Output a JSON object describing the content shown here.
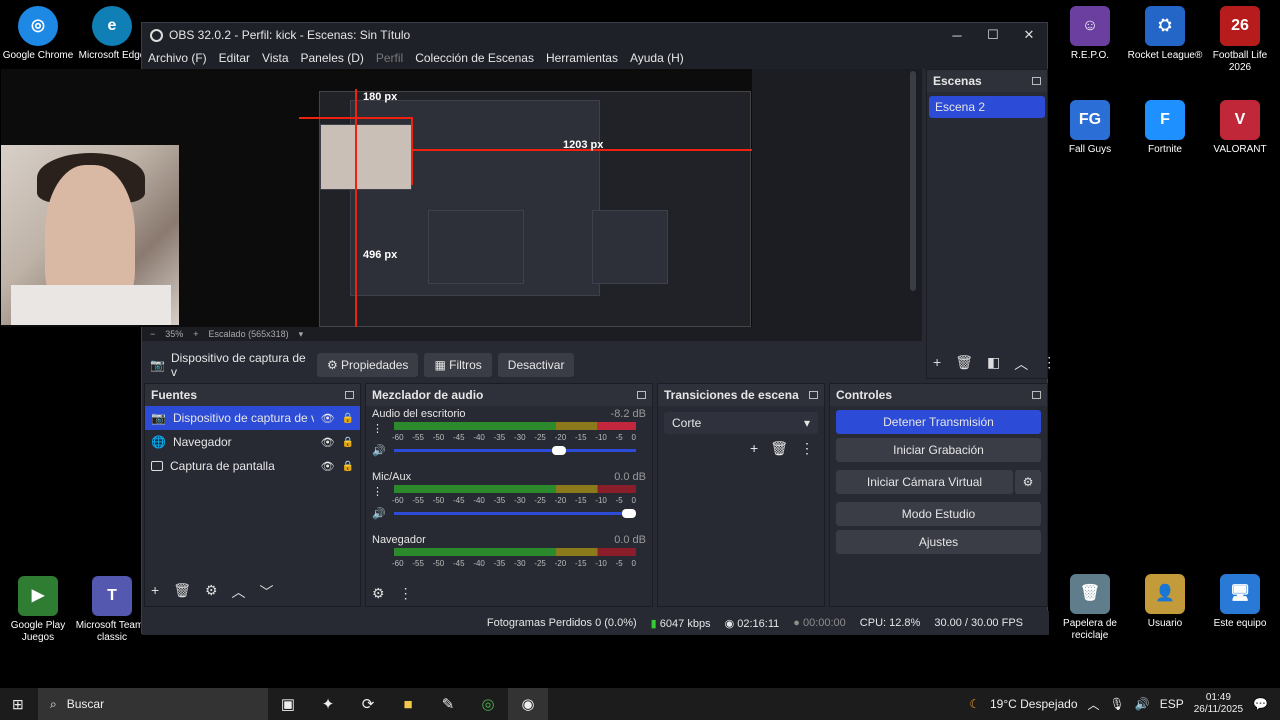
{
  "desktop": {
    "left_icons": [
      {
        "label": "Google Chrome",
        "color": "#1e88e5"
      },
      {
        "label": "Microsoft Edge",
        "color": "#0f7fb5"
      },
      {
        "label": "",
        "color": "#1b2838"
      },
      {
        "label": "",
        "color": "#222"
      },
      {
        "label": "Google Play Juegos",
        "color": "#2e7d32"
      },
      {
        "label": "Microsoft Teams classic",
        "color": "#5558af"
      }
    ],
    "right_icons": [
      {
        "label": "R.E.P.O.",
        "color": "#6a3fa0"
      },
      {
        "label": "Rocket League®",
        "color": "#2466c7"
      },
      {
        "label": "Football Life 2026",
        "color": "#b71c1c"
      },
      {
        "label": "Fall Guys",
        "color": "#2b6fd6"
      },
      {
        "label": "Fortnite",
        "color": "#1e90ff"
      },
      {
        "label": "VALORANT",
        "color": "#c0283a"
      },
      {
        "label": "Papelera de reciclaje",
        "color": "#607d8b"
      },
      {
        "label": "Usuario",
        "color": "#c49b3a"
      },
      {
        "label": "Este equipo",
        "color": "#2979d6"
      }
    ]
  },
  "obs": {
    "title": "OBS 32.0.2 - Perfil: kick - Escenas: Sin Título",
    "menu": [
      "Archivo (F)",
      "Editar",
      "Vista",
      "Paneles (D)",
      "Perfil",
      "Colección de Escenas",
      "Herramientas",
      "Ayuda (H)"
    ],
    "preview": {
      "labels": [
        "180 px",
        "1203 px",
        "496 px"
      ],
      "zoom": "35%",
      "scaling": "Escalado (565x318)"
    },
    "source_toolbar": {
      "source_name": "Dispositivo de captura de v",
      "properties": "Propiedades",
      "filters": "Filtros",
      "deactivate": "Desactivar"
    },
    "scenes": {
      "title": "Escenas",
      "items": [
        "Escena 2"
      ]
    },
    "sources": {
      "title": "Fuentes",
      "items": [
        "Dispositivo de captura de vide",
        "Navegador",
        "Captura de pantalla"
      ]
    },
    "mixer": {
      "title": "Mezclador de audio",
      "channels": [
        {
          "name": "Audio del escritorio",
          "db": "-8.2 dB"
        },
        {
          "name": "Mic/Aux",
          "db": "0.0 dB"
        },
        {
          "name": "Navegador",
          "db": "0.0 dB"
        }
      ],
      "ticks": [
        "-60",
        "-55",
        "-50",
        "-45",
        "-40",
        "-35",
        "-30",
        "-25",
        "-20",
        "-15",
        "-10",
        "-5",
        "0"
      ]
    },
    "transitions": {
      "title": "Transiciones de escena",
      "selected": "Corte"
    },
    "controls": {
      "title": "Controles",
      "stop_stream": "Detener Transmisión",
      "start_recording": "Iniciar Grabación",
      "start_virtual_cam": "Iniciar Cámara Virtual",
      "studio_mode": "Modo Estudio",
      "settings": "Ajustes"
    },
    "status": {
      "dropped": "Fotogramas Perdidos 0 (0.0%)",
      "bitrate": "6047 kbps",
      "stream_time": "02:16:11",
      "rec_time": "00:00:00",
      "cpu": "CPU: 12.8%",
      "fps": "30.00 / 30.00 FPS"
    }
  },
  "taskbar": {
    "search_placeholder": "Buscar",
    "weather": "19°C  Despejado",
    "lang": "ESP",
    "time": "01:49",
    "date": "26/11/2025"
  }
}
